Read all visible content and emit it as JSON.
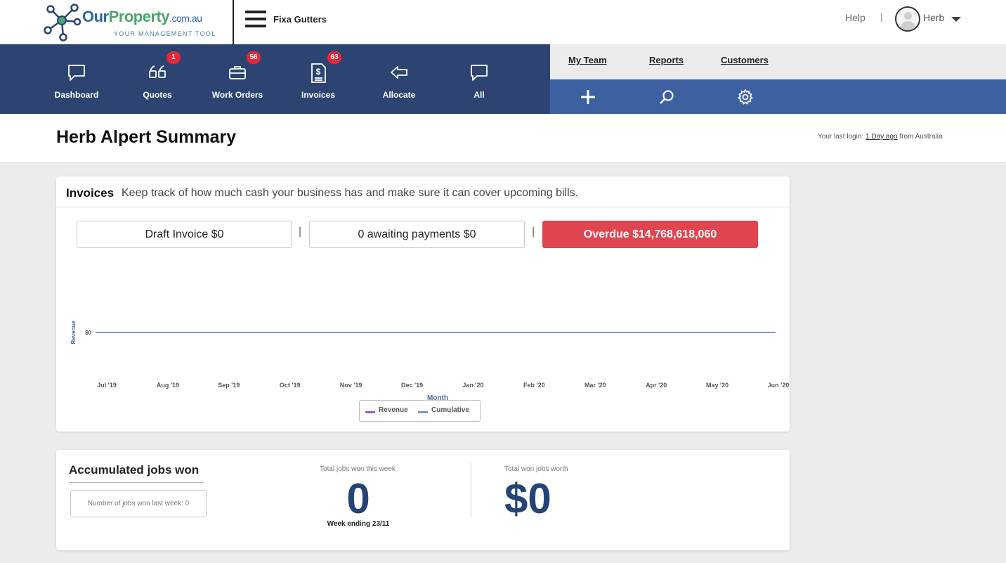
{
  "header": {
    "logo": {
      "brand_our": "Our",
      "brand_property": "Property",
      "brand_domain": ".com.au",
      "tagline": "YOUR MANAGEMENT TOOL"
    },
    "company_name": "Fixa Gutters",
    "help_label": "Help",
    "separator": "|",
    "user_name": "Herb"
  },
  "nav": {
    "items": [
      {
        "label": "Dashboard",
        "icon": "speech-bubble-icon",
        "badge": ""
      },
      {
        "label": "Quotes",
        "icon": "quote-marks-icon",
        "badge": "1"
      },
      {
        "label": "Work Orders",
        "icon": "briefcase-icon",
        "badge": "56"
      },
      {
        "label": "Invoices",
        "icon": "dollar-document-icon",
        "badge": "63"
      },
      {
        "label": "Allocate",
        "icon": "arrow-left-icon",
        "badge": ""
      },
      {
        "label": "All",
        "icon": "speech-bubble-icon",
        "badge": ""
      }
    ]
  },
  "subnav": {
    "links": [
      "My Team",
      "Reports",
      "Customers"
    ],
    "actions": [
      "plus-icon",
      "search-icon",
      "gear-icon"
    ]
  },
  "page": {
    "title": "Herb Alpert Summary",
    "last_login_prefix": "Your last login:",
    "last_login_time": "1 Day ago",
    "last_login_suffix": "from Australia"
  },
  "invoices": {
    "title": "Invoices",
    "description": "Keep track of how much cash your business has and make sure it can cover upcoming bills.",
    "draft_label": "Draft Invoice $0",
    "awaiting_label": "0 awaiting payments $0",
    "overdue_label": "Overdue $14,768,618,060",
    "separator": "|"
  },
  "chart_data": {
    "type": "line",
    "x": [
      "Jul '19",
      "Aug '19",
      "Sep '19",
      "Oct '19",
      "Nov '19",
      "Dec '19",
      "Jan '20",
      "Feb '20",
      "Mar '20",
      "Apr '20",
      "May '20",
      "Jun '20"
    ],
    "series": [
      {
        "name": "Revenue",
        "color": "#9b59c9",
        "values": [
          0,
          0,
          0,
          0,
          0,
          0,
          0,
          0,
          0,
          0,
          0,
          0
        ]
      },
      {
        "name": "Cumulative",
        "color": "#7b98c9",
        "values": [
          0,
          0,
          0,
          0,
          0,
          0,
          0,
          0,
          0,
          0,
          0,
          0
        ]
      }
    ],
    "y_ticks": [
      "$0"
    ],
    "xlabel": "Month",
    "ylabel": "Revenue",
    "legend_position": "bottom-center"
  },
  "jobs": {
    "title": "Accumulated jobs won",
    "last_week_label": "Number of jobs won last week: 0",
    "week_label": "Total jobs won this week",
    "week_value": "0",
    "week_ending": "Week ending 23/11",
    "worth_label": "Total won jobs worth",
    "worth_value": "$0"
  },
  "colors": {
    "nav_bg": "#2d4371",
    "action_bg": "#3d61a0",
    "badge": "#e5283a",
    "overdue": "#e04550",
    "stat_number": "#244476"
  }
}
